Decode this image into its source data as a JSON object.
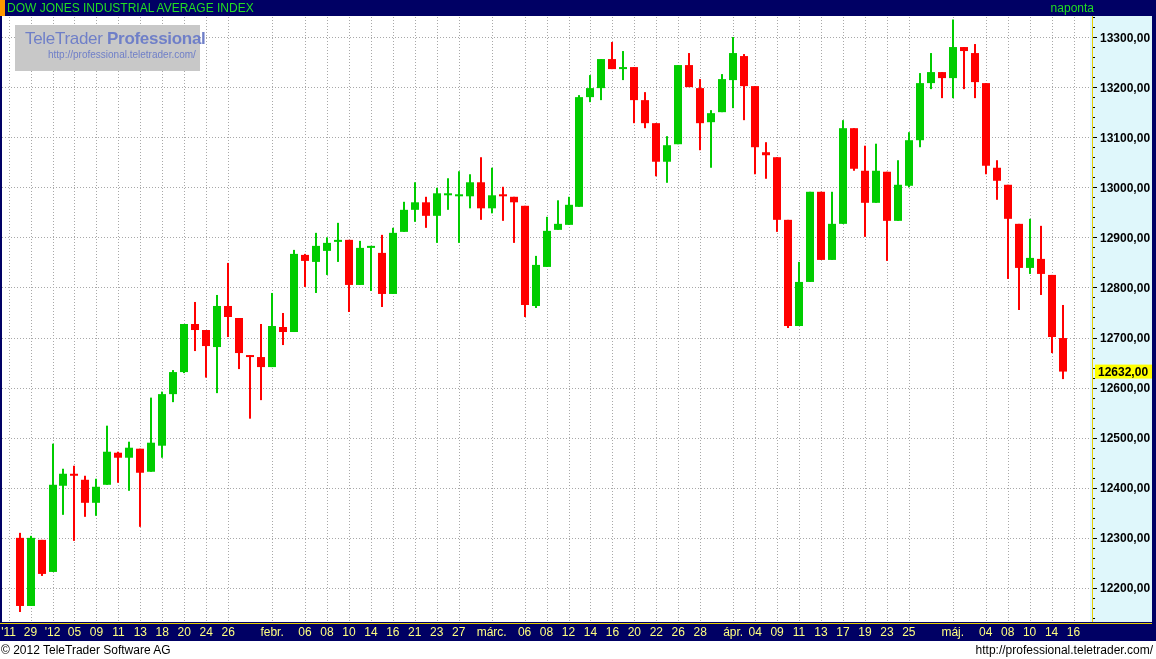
{
  "header": {
    "title": "DOW JONES INDUSTRIAL AVERAGE INDEX",
    "period": "naponta"
  },
  "logo": {
    "title": "TeleTrader **Professional**",
    "url": "http://professional.teletrader.com/"
  },
  "chart_data": {
    "type": "candlestick",
    "grid": true,
    "ylim": [
      12132,
      13340
    ],
    "categories": [
      "'11",
      null,
      "29",
      null,
      "'12",
      null,
      "05",
      null,
      "09",
      null,
      "11",
      null,
      "13",
      null,
      "18",
      null,
      "20",
      null,
      "24",
      null,
      "26",
      null,
      null,
      null,
      "febr.",
      null,
      null,
      "06",
      null,
      "08",
      null,
      "10",
      null,
      "14",
      null,
      "16",
      null,
      "21",
      null,
      "23",
      null,
      "27",
      null,
      null,
      "márc.",
      null,
      null,
      "06",
      null,
      "08",
      null,
      "12",
      null,
      "14",
      null,
      "16",
      null,
      "20",
      null,
      "22",
      null,
      "26",
      null,
      "28",
      null,
      null,
      "ápr.",
      null,
      "04",
      null,
      "09",
      null,
      "11",
      null,
      "13",
      null,
      "17",
      null,
      "19",
      null,
      "23",
      null,
      "25",
      null,
      null,
      null,
      "máj.",
      null,
      null,
      "04",
      null,
      "08",
      null,
      "10",
      null,
      "14",
      null,
      "16"
    ],
    "yticks": [
      {
        "value": 12200,
        "label": "12200,00"
      },
      {
        "value": 12300,
        "label": "12300,00"
      },
      {
        "value": 12400,
        "label": "12400,00"
      },
      {
        "value": 12500,
        "label": "12500,00"
      },
      {
        "value": 12600,
        "label": "12600,00"
      },
      {
        "value": 12700,
        "label": "12700,00"
      },
      {
        "value": 12800,
        "label": "12800,00"
      },
      {
        "value": 12900,
        "label": "12900,00"
      },
      {
        "value": 13000,
        "label": "13000,00"
      },
      {
        "value": 13100,
        "label": "13100,00"
      },
      {
        "value": 13200,
        "label": "13200,00"
      },
      {
        "value": 13300,
        "label": "13300,00"
      }
    ],
    "ohlc": [
      null,
      [
        12300,
        12310,
        12152,
        12164
      ],
      [
        12164,
        12304,
        12164,
        12300
      ],
      [
        12296,
        12296,
        12224,
        12228
      ],
      [
        12232,
        12488,
        12232,
        12406
      ],
      [
        12404,
        12438,
        12346,
        12428
      ],
      [
        12428,
        12444,
        12294,
        12426
      ],
      [
        12416,
        12424,
        12342,
        12370
      ],
      [
        12370,
        12418,
        12344,
        12402
      ],
      [
        12406,
        12524,
        12406,
        12472
      ],
      [
        12470,
        12472,
        12410,
        12460
      ],
      [
        12460,
        12492,
        12394,
        12480
      ],
      [
        12478,
        12478,
        12322,
        12430
      ],
      [
        12432,
        12580,
        12432,
        12490
      ],
      [
        12484,
        12592,
        12460,
        12587
      ],
      [
        12587,
        12635,
        12571,
        12631
      ],
      [
        12631,
        12727,
        12629,
        12727
      ],
      [
        12727,
        12771,
        12673,
        12715
      ],
      [
        12715,
        12715,
        12620,
        12683
      ],
      [
        12681,
        12785,
        12589,
        12763
      ],
      [
        12763,
        12849,
        12701,
        12741
      ],
      [
        12739,
        12739,
        12637,
        12669
      ],
      [
        12665,
        12665,
        12538,
        12663
      ],
      [
        12661,
        12727,
        12575,
        12641
      ],
      [
        12641,
        12789,
        12641,
        12723
      ],
      [
        12721,
        12749,
        12685,
        12711
      ],
      [
        12711,
        12875,
        12711,
        12867
      ],
      [
        12865,
        12867,
        12801,
        12853
      ],
      [
        12851,
        12909,
        12789,
        12883
      ],
      [
        12873,
        12900,
        12825,
        12889
      ],
      [
        12891,
        12929,
        12851,
        12895
      ],
      [
        12895,
        12895,
        12751,
        12805
      ],
      [
        12805,
        12893,
        12805,
        12879
      ],
      [
        12879,
        12883,
        12793,
        12883
      ],
      [
        12869,
        12905,
        12761,
        12787
      ],
      [
        12787,
        12919,
        12787,
        12909
      ],
      [
        12911,
        12971,
        12911,
        12955
      ],
      [
        12955,
        13010,
        12931,
        12970
      ],
      [
        12970,
        12981,
        12919,
        12943
      ],
      [
        12943,
        12999,
        12889,
        12988
      ],
      [
        12984,
        13018,
        12955,
        12988
      ],
      [
        12982,
        13032,
        12889,
        12986
      ],
      [
        12982,
        13026,
        12958,
        13010
      ],
      [
        13010,
        13060,
        12935,
        12958
      ],
      [
        12958,
        13039,
        12948,
        12984
      ],
      [
        12986,
        13001,
        12933,
        12982
      ],
      [
        12981,
        12981,
        12889,
        12970
      ],
      [
        12963,
        12963,
        12741,
        12765
      ],
      [
        12763,
        12863,
        12759,
        12845
      ],
      [
        12841,
        12941,
        12841,
        12913
      ],
      [
        12915,
        12974,
        12915,
        12927
      ],
      [
        12925,
        12981,
        12925,
        12965
      ],
      [
        12961,
        13184,
        12961,
        13180
      ],
      [
        13180,
        13224,
        13170,
        13198
      ],
      [
        13198,
        13256,
        13174,
        13256
      ],
      [
        13256,
        13290,
        13236,
        13236
      ],
      [
        13236,
        13272,
        13214,
        13240
      ],
      [
        13240,
        13240,
        13128,
        13174
      ],
      [
        13174,
        13190,
        13118,
        13128
      ],
      [
        13128,
        13128,
        13022,
        13051
      ],
      [
        13051,
        13102,
        13009,
        13084
      ],
      [
        13086,
        13244,
        13086,
        13244
      ],
      [
        13244,
        13268,
        13200,
        13200
      ],
      [
        13198,
        13216,
        13074,
        13128
      ],
      [
        13130,
        13154,
        13039,
        13148
      ],
      [
        13150,
        13226,
        13150,
        13216
      ],
      [
        13214,
        13300,
        13158,
        13268
      ],
      [
        13262,
        13266,
        13134,
        13202
      ],
      [
        13202,
        13202,
        13026,
        13080
      ],
      [
        13070,
        13090,
        13017,
        13064
      ],
      [
        13060,
        13060,
        12911,
        12935
      ],
      [
        12935,
        12935,
        12719,
        12723
      ],
      [
        12723,
        12851,
        12723,
        12811
      ],
      [
        12811,
        12991,
        12811,
        12991
      ],
      [
        12991,
        12991,
        12855,
        12855
      ],
      [
        12855,
        12991,
        12855,
        12927
      ],
      [
        12927,
        13134,
        12927,
        13118
      ],
      [
        13118,
        13118,
        13033,
        13037
      ],
      [
        13033,
        13083,
        12901,
        12969
      ],
      [
        12969,
        13087,
        12969,
        13033
      ],
      [
        13031,
        13031,
        12853,
        12933
      ],
      [
        12933,
        13054,
        12933,
        13005
      ],
      [
        13003,
        13110,
        13000,
        13094
      ],
      [
        13094,
        13228,
        13080,
        13208
      ],
      [
        13208,
        13268,
        13196,
        13230
      ],
      [
        13230,
        13230,
        13178,
        13218
      ],
      [
        13218,
        13335,
        13178,
        13280
      ],
      [
        13280,
        13280,
        13196,
        13272
      ],
      [
        13268,
        13286,
        13178,
        13210
      ],
      [
        13208,
        13208,
        13026,
        13043
      ],
      [
        13039,
        13054,
        12975,
        13013
      ],
      [
        13005,
        13005,
        12817,
        12937
      ],
      [
        12927,
        12927,
        12755,
        12839
      ],
      [
        12839,
        12937,
        12827,
        12859
      ],
      [
        12857,
        12923,
        12785,
        12827
      ],
      [
        12825,
        12825,
        12669,
        12701
      ],
      [
        12699,
        12765,
        12617,
        12632
      ],
      null
    ],
    "ref_lines": [
      {
        "label": "12632,00"
      }
    ]
  },
  "footer": {
    "copyright": "© 2012 TeleTrader Software AG",
    "url": "http://professional.teletrader.com/"
  }
}
